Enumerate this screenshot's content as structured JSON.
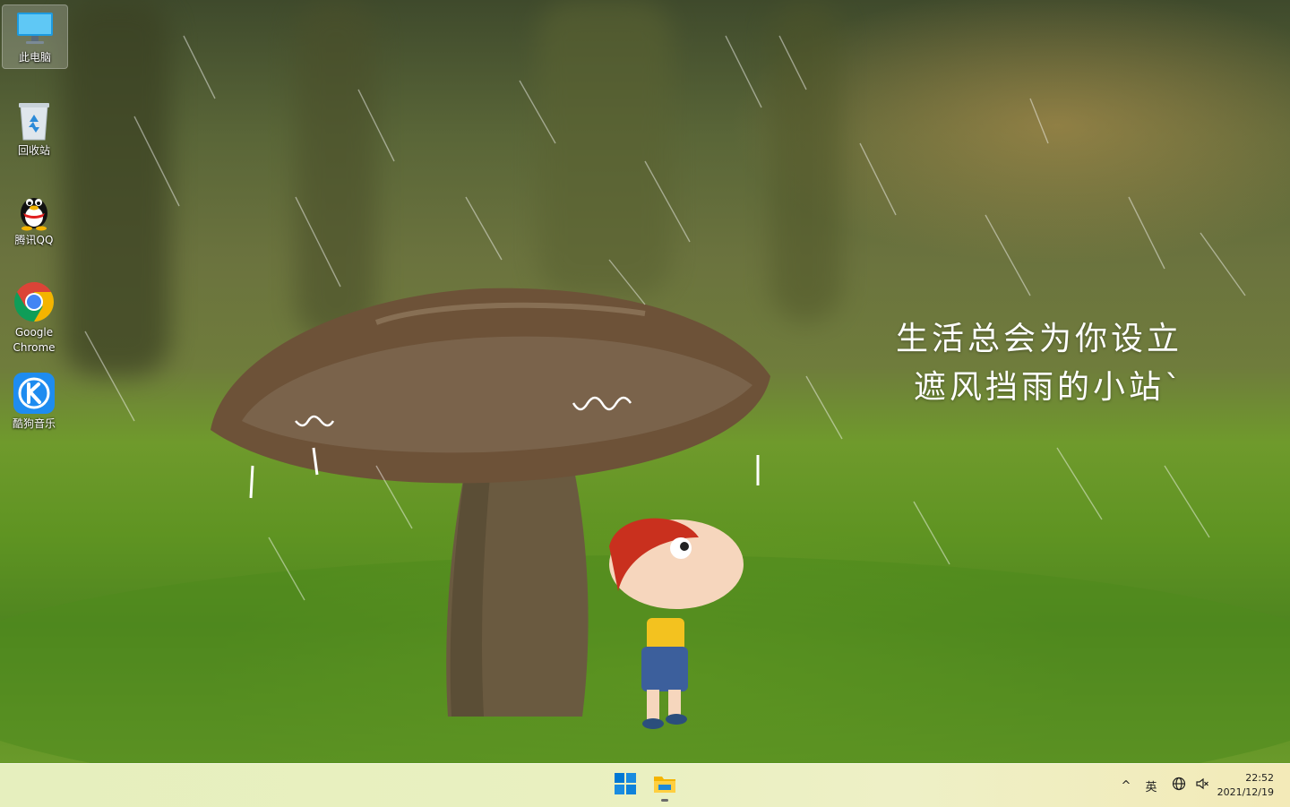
{
  "desktop": {
    "wallpaper_text": {
      "line1": "生活总会为你设立",
      "line2": "遮风挡雨的小站`"
    },
    "icons": [
      {
        "label": "此电脑",
        "icon": "computer-icon"
      },
      {
        "label": "回收站",
        "icon": "recycle-bin-icon"
      },
      {
        "label": "腾讯QQ",
        "icon": "qq-penguin-icon"
      },
      {
        "label": "Google Chrome",
        "icon": "chrome-icon"
      },
      {
        "label": "酷狗音乐",
        "icon": "kugou-music-icon"
      }
    ]
  },
  "taskbar": {
    "pinned": [
      {
        "name": "start",
        "icon": "windows-logo-icon"
      },
      {
        "name": "file-explorer",
        "icon": "folder-icon"
      }
    ],
    "tray": {
      "chevron": "^",
      "language": "英"
    },
    "clock": {
      "time": "22:52",
      "date": "2021/12/19"
    }
  },
  "colors": {
    "windows_blue": "#0078d4",
    "chrome_red": "#db4437",
    "chrome_yellow": "#f4b400",
    "chrome_green": "#0f9d58",
    "kugou_blue": "#1e8cf0"
  }
}
